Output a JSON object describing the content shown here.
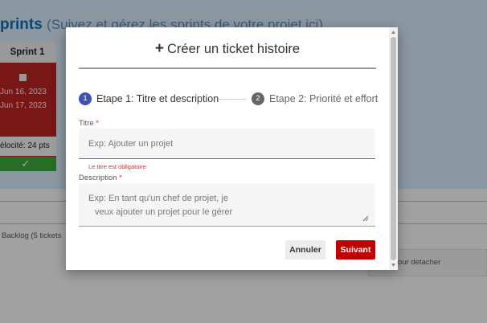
{
  "background": {
    "page_title": "prints",
    "page_subtitle": "(Suivez et gérez les sprints de votre projet ici)",
    "sprint": {
      "name": "Sprint 1",
      "start_date": "Jun 16, 2023",
      "end_date": "Jun 17, 2023",
      "velocity": "élocité: 24 pts"
    },
    "backlog_label": "Backlog (5 tickets",
    "detach_label": "our detacher"
  },
  "modal": {
    "title": "Créer un ticket histoire",
    "steps": [
      {
        "number": "1",
        "label": "Etape 1: Titre et description"
      },
      {
        "number": "2",
        "label": "Etape 2: Priorité et effort"
      }
    ],
    "title_field": {
      "label": "Titre",
      "required_mark": "*",
      "placeholder": "Exp: Ajouter un projet",
      "error": "Le titre est obligatoire"
    },
    "description_field": {
      "label": "Description",
      "required_mark": "*",
      "placeholder_line1": "Exp: En tant qu'un chef de projet, je",
      "placeholder_line2": "veux ajouter un projet pour le gérer"
    },
    "buttons": {
      "cancel": "Annuler",
      "next": "Suivant"
    }
  },
  "colors": {
    "primary_blue": "#3f51b5",
    "danger_red": "#c00000",
    "error_red": "#d32f2f",
    "sprint_red": "#b82323",
    "success_green": "#3aa63a"
  }
}
